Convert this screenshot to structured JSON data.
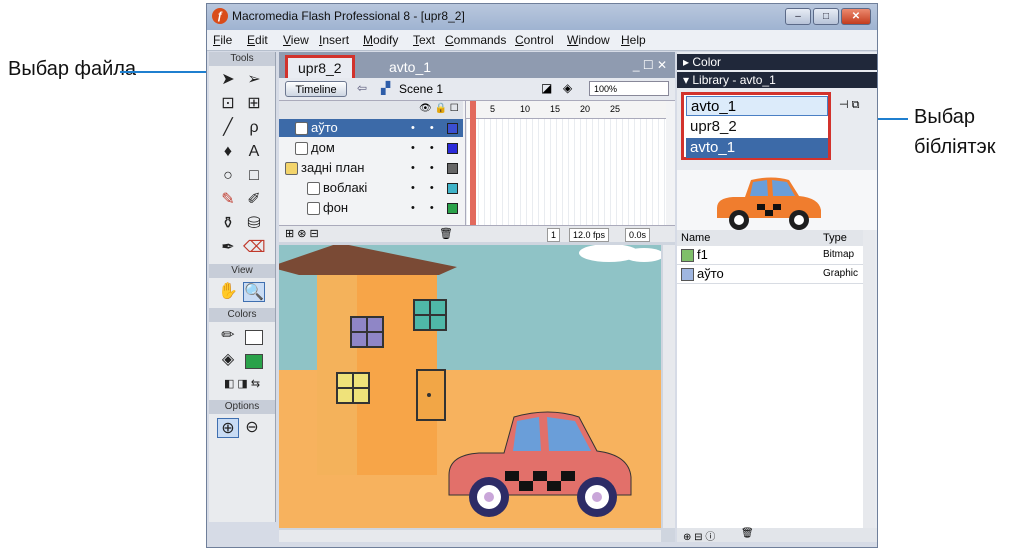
{
  "callouts": {
    "file_select": "Выбар файла",
    "library_select_1": "Выбар",
    "library_select_2": "бібліятэк"
  },
  "window": {
    "title": "Macromedia Flash Professional 8 - [upr8_2]",
    "min": "–",
    "max": "□",
    "close": "✕"
  },
  "menu": [
    "File",
    "Edit",
    "View",
    "Insert",
    "Modify",
    "Text",
    "Commands",
    "Control",
    "Window",
    "Help"
  ],
  "tools": {
    "header": "Tools",
    "view_header": "View",
    "colors_header": "Colors",
    "options_header": "Options"
  },
  "document": {
    "tabs": [
      "upr8_2",
      "avto_1"
    ],
    "controls": "_ ☐ ✕",
    "timeline_button": "Timeline",
    "scene": "Scene 1",
    "zoom": "100%"
  },
  "timeline": {
    "layers": [
      {
        "name": "аўто",
        "color": "#3b4fd1",
        "active": true
      },
      {
        "name": "дом",
        "color": "#2b2bd9",
        "active": false
      },
      {
        "name": "задні план",
        "color": "#666666",
        "active": false
      },
      {
        "name": "воблакі",
        "color": "#3fb3c8",
        "active": false
      },
      {
        "name": "фон",
        "color": "#2aa24a",
        "active": false
      }
    ],
    "frame_numbers": [
      "5",
      "10",
      "15",
      "20",
      "25"
    ],
    "current_frame": "1",
    "fps": "12.0 fps",
    "time": "0.0s"
  },
  "library": {
    "color_panel": "Color",
    "panel_title": "Library - avto_1",
    "options": [
      "avto_1",
      "upr8_2",
      "avto_1"
    ],
    "col_name": "Name",
    "col_type": "Type",
    "items": [
      {
        "name": "f1",
        "type": "Bitmap"
      },
      {
        "name": "аўто",
        "type": "Graphic"
      }
    ]
  },
  "colors": {
    "accent": "#d2322c",
    "callout_arrow": "#1f7fcf",
    "selection": "#3c6aa8"
  }
}
